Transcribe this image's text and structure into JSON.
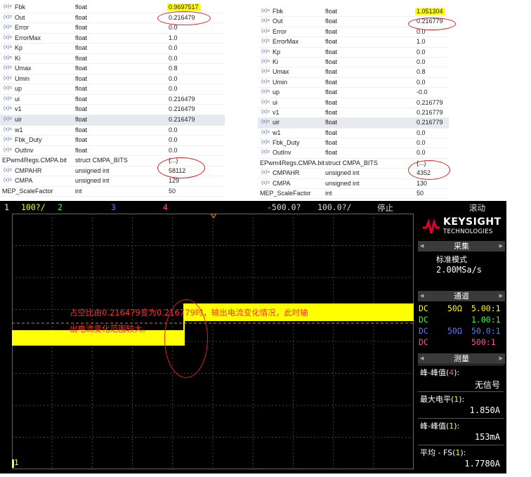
{
  "left_panel": {
    "rows": [
      {
        "name": "Fbk",
        "type": "float",
        "value": "0.9697517",
        "highlight": true,
        "icon": true
      },
      {
        "name": "Out",
        "type": "float",
        "value": "0.216479",
        "icon": true
      },
      {
        "name": "Error",
        "type": "float",
        "value": "0.0",
        "icon": true
      },
      {
        "name": "ErrorMax",
        "type": "float",
        "value": "1.0",
        "icon": true
      },
      {
        "name": "Kp",
        "type": "float",
        "value": "0.0",
        "icon": true
      },
      {
        "name": "Ki",
        "type": "float",
        "value": "0.0",
        "icon": true
      },
      {
        "name": "Umax",
        "type": "float",
        "value": "0.8",
        "icon": true
      },
      {
        "name": "Umin",
        "type": "float",
        "value": "0.0",
        "icon": true
      },
      {
        "name": "up",
        "type": "float",
        "value": "0.0",
        "icon": true
      },
      {
        "name": "ui",
        "type": "float",
        "value": "0.216479",
        "icon": true
      },
      {
        "name": "v1",
        "type": "float",
        "value": "0.216479",
        "icon": true
      },
      {
        "name": "uir",
        "type": "float",
        "value": "0.216479",
        "icon": true,
        "selected": true
      },
      {
        "name": "w1",
        "type": "float",
        "value": "0.0",
        "icon": true
      },
      {
        "name": "Fbk_Duty",
        "type": "float",
        "value": "0.0",
        "icon": true
      },
      {
        "name": "OutInv",
        "type": "float",
        "value": "0.0",
        "icon": true
      },
      {
        "name": "EPwm4Regs.CMPA.bit",
        "type": "struct CMPA_BITS",
        "value": "{...}",
        "icon": false
      },
      {
        "name": "CMPAHR",
        "type": "unsigned int",
        "value": "58112",
        "icon": true
      },
      {
        "name": "CMPA",
        "type": "unsigned int",
        "value": "129",
        "icon": true
      },
      {
        "name": "MEP_ScaleFactor",
        "type": "int",
        "value": "50",
        "icon": false
      }
    ]
  },
  "right_panel": {
    "rows": [
      {
        "name": "Fbk",
        "type": "float",
        "value": "1.051304",
        "highlight": true,
        "icon": true
      },
      {
        "name": "Out",
        "type": "float",
        "value": "0.216779",
        "icon": true
      },
      {
        "name": "Error",
        "type": "float",
        "value": "0.0",
        "icon": true
      },
      {
        "name": "ErrorMax",
        "type": "float",
        "value": "1.0",
        "icon": true
      },
      {
        "name": "Kp",
        "type": "float",
        "value": "0.0",
        "icon": true
      },
      {
        "name": "Ki",
        "type": "float",
        "value": "0.0",
        "icon": true
      },
      {
        "name": "Umax",
        "type": "float",
        "value": "0.8",
        "icon": true
      },
      {
        "name": "Umin",
        "type": "float",
        "value": "0.0",
        "icon": true
      },
      {
        "name": "up",
        "type": "float",
        "value": "-0.0",
        "icon": true
      },
      {
        "name": "ui",
        "type": "float",
        "value": "0.216779",
        "icon": true
      },
      {
        "name": "v1",
        "type": "float",
        "value": "0.216779",
        "icon": true
      },
      {
        "name": "uir",
        "type": "float",
        "value": "0.216779",
        "icon": true,
        "selected": true
      },
      {
        "name": "w1",
        "type": "float",
        "value": "0.0",
        "icon": true
      },
      {
        "name": "Fbk_Duty",
        "type": "float",
        "value": "0.0",
        "icon": true
      },
      {
        "name": "OutInv",
        "type": "float",
        "value": "0.0",
        "icon": true
      },
      {
        "name": "EPwm4Regs.CMPA.bit",
        "type": "struct CMPA_BITS",
        "value": "{...}",
        "icon": false
      },
      {
        "name": "CMPAHR",
        "type": "unsigned int",
        "value": "4352",
        "icon": true
      },
      {
        "name": "CMPA",
        "type": "unsigned int",
        "value": "130",
        "icon": true
      },
      {
        "name": "MEP_ScaleFactor",
        "type": "int",
        "value": "50",
        "icon": false
      }
    ]
  },
  "var_icon_glyph": "(x)=",
  "scope": {
    "top": {
      "ch1_num": "1",
      "ch1_scale": "100?/",
      "ch2_num": "2",
      "ch3_num": "3",
      "ch4_num": "4",
      "time_offset": "-500.0?",
      "time_scale": "100.0?/",
      "run_state": "停止",
      "mode": "滚动"
    },
    "annotation_line1": "占空比由0.216479变为0.216779时，输出电流变化情况，此时输",
    "annotation_line2": "出电流变化范围较大。",
    "ground_marker": "1",
    "brand_name": "KEYSIGHT",
    "brand_sub": "TECHNOLOGIES",
    "acquire": {
      "title": "采集",
      "mode": "标准模式",
      "rate": "2.00MSa/s"
    },
    "channels": {
      "title": "通道",
      "rows": [
        {
          "coupling": "DC",
          "imp": "50Ω",
          "probe": "5.00:1",
          "color": "#ffff00"
        },
        {
          "coupling": "DC",
          "imp": "",
          "probe": "1.00:1",
          "color": "#33ff33"
        },
        {
          "coupling": "DC",
          "imp": "50Ω",
          "probe": "50.0:1",
          "color": "#5a7bff"
        },
        {
          "coupling": "DC",
          "imp": "",
          "probe": "500:1",
          "color": "#ff4fa0"
        }
      ]
    },
    "measure": {
      "title": "测量",
      "items": [
        {
          "label_pre": "峰-峰值(",
          "label_ch": "4",
          "label_post": "):",
          "value": "无信号",
          "ch_color": "#ff4fa0"
        },
        {
          "label_pre": "最大电平(",
          "label_ch": "1",
          "label_post": "):",
          "value": "1.850A",
          "ch_color": "#ffff00"
        },
        {
          "label_pre": "峰-峰值(",
          "label_ch": "1",
          "label_post": "):",
          "value": "153mA",
          "ch_color": "#ffff00"
        },
        {
          "label_pre": "平均 - FS(",
          "label_ch": "1",
          "label_post": "):",
          "value": "1.7780A",
          "ch_color": "#ffff00"
        }
      ]
    },
    "colors": {
      "ch1": "#ffff00",
      "ch2": "#33ff33",
      "ch3": "#5a7bff",
      "ch4": "#ff4fa0",
      "annotation": "#ff3030"
    }
  }
}
